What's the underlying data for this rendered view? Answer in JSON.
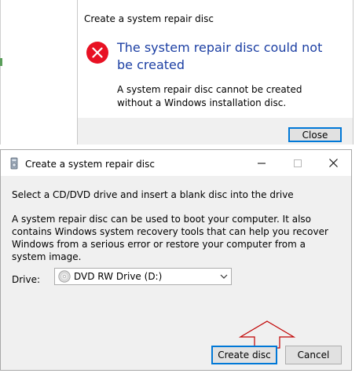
{
  "error_dialog": {
    "title": "Create a system repair disc",
    "heading": "The system repair disc could not be created",
    "message": "A system repair disc cannot be created without a Windows installation disc.",
    "close_label": "Close",
    "icon": "error-icon",
    "heading_color": "#1c3fa3",
    "icon_color": "#e81123"
  },
  "main_dialog": {
    "title": "Create a system repair disc",
    "app_icon": "repair-disc-app-icon",
    "window_controls": [
      "minimize",
      "maximize",
      "close"
    ],
    "instruction": "Select a CD/DVD drive and insert a blank disc into the drive",
    "description": "A system repair disc can be used to boot your computer. It also contains Windows system recovery tools that can help you recover Windows from a serious error or restore your computer from a system image.",
    "drive_label": "Drive:",
    "drive_value": "DVD RW Drive (D:)",
    "create_label": "Create disc",
    "cancel_label": "Cancel",
    "annotation": "arrow-pointing-to-create-disc",
    "annotation_color": "#c00000",
    "accent_color": "#0078d7"
  }
}
